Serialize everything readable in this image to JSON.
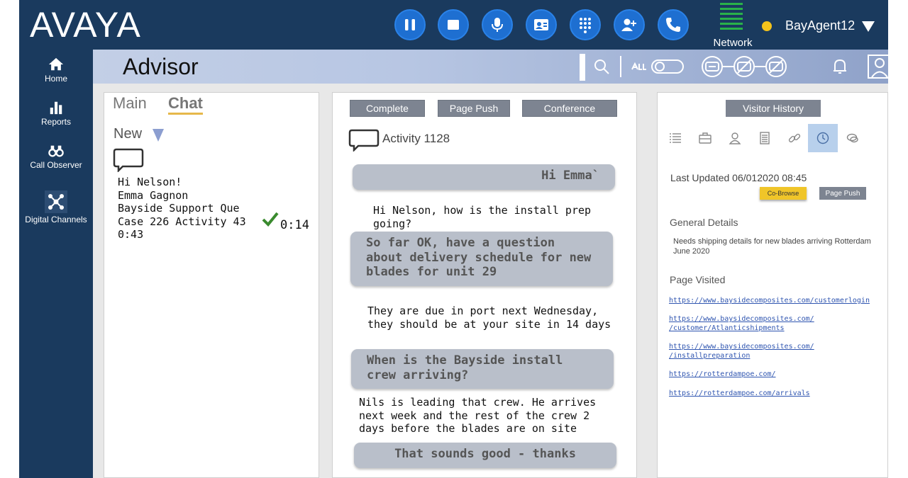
{
  "brand": {
    "logo_text": "AVAYA"
  },
  "topbar": {
    "buttons": [
      {
        "name": "pause-icon"
      },
      {
        "name": "stop-icon"
      },
      {
        "name": "microphone-icon"
      },
      {
        "name": "contact-card-icon"
      },
      {
        "name": "dialpad-icon"
      },
      {
        "name": "add-user-icon"
      },
      {
        "name": "phone-icon"
      }
    ],
    "network_label": "Network",
    "agent_status_color": "#f3c21b",
    "agent_name": "BayAgent12"
  },
  "nav": {
    "items": [
      {
        "label": "Home",
        "icon": "home-icon"
      },
      {
        "label": "Reports",
        "icon": "bar-chart-icon"
      },
      {
        "label": "Call Observer",
        "icon": "binoculars-icon"
      },
      {
        "label": "Digital Channels",
        "icon": "network-nodes-icon"
      }
    ]
  },
  "header": {
    "title": "Advisor"
  },
  "left_panel": {
    "tabs": {
      "main": "Main",
      "chat": "Chat"
    },
    "filter": "New",
    "card": {
      "lines": [
        "Hi Nelson!",
        "Emma Gagnon",
        "Bayside Support Que",
        "Case 226 Activity 43",
        "0:43"
      ],
      "timer": "0:14"
    }
  },
  "mid_panel": {
    "buttons": {
      "complete": "Complete",
      "page_push": "Page Push",
      "conference": "Conference"
    },
    "activity": "Activity 1128",
    "messages": [
      {
        "from": "customer",
        "text": "Hi Emma`"
      },
      {
        "from": "agent",
        "text": "Hi Nelson, how is the install prep going?"
      },
      {
        "from": "customer",
        "text": "So far OK, have a question about delivery schedule for new blades for unit 29"
      },
      {
        "from": "agent",
        "text": "They are due in port next Wednesday, they should be at your site in 14 days"
      },
      {
        "from": "customer",
        "text": "When is the Bayside install crew arriving?"
      },
      {
        "from": "agent",
        "text": "Nils is leading that crew. He arrives next week and the rest of the crew 2 days before the blades are on site"
      },
      {
        "from": "customer",
        "text": "That sounds good -  thanks"
      }
    ]
  },
  "right_panel": {
    "visitor_history": "Visitor History",
    "last_updated": "Last Updated 06/012020   08:45",
    "cobrowse": "Co-Browse",
    "page_push": "Page Push",
    "general_heading": "General Details",
    "general_text": "Needs shipping  details  for new blades  arriving Rotterdam  June 2020",
    "pages_heading": "Page Visited",
    "links": [
      "https://www.baysidecomposites.com/customerlogin",
      "https://www.baysidecomposites.com/\n/customer/Atlanticshipments",
      "https://www.baysidecomposites.com/\n/installpreparation",
      "https://rotterdampoe.com/",
      "https://rotterdampoe.com/arrivals"
    ]
  }
}
